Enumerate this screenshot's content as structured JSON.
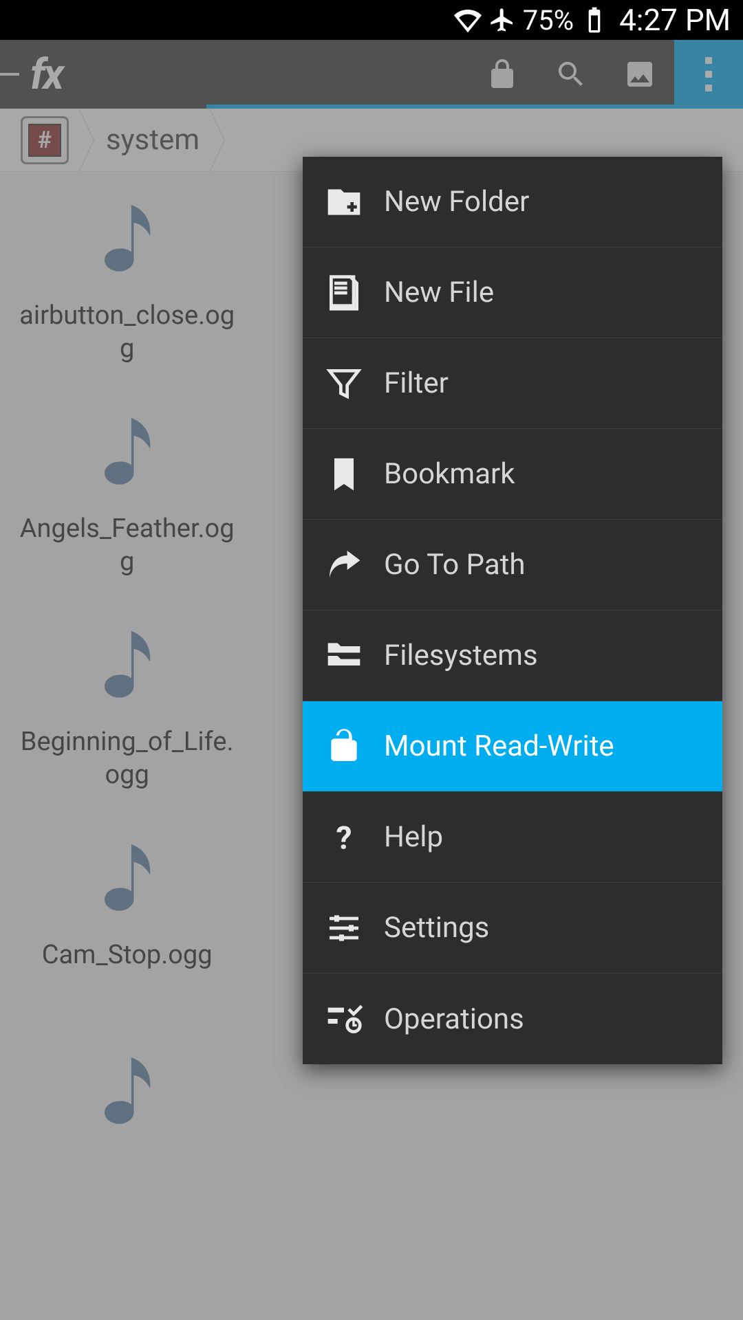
{
  "status": {
    "battery": "75%",
    "time": "4:27 PM"
  },
  "breadcrumb": {
    "root_symbol": "#",
    "segments": [
      "system"
    ]
  },
  "files": [
    {
      "name": "airbutton_close.ogg"
    },
    {
      "name": "Angels_Feather.ogg"
    },
    {
      "name": "Beginning_of_Life.ogg"
    },
    {
      "name": "Cam_Stop.ogg"
    }
  ],
  "menu": {
    "items": [
      {
        "label": "New Folder",
        "highlight": false
      },
      {
        "label": "New File",
        "highlight": false
      },
      {
        "label": "Filter",
        "highlight": false
      },
      {
        "label": "Bookmark",
        "highlight": false
      },
      {
        "label": "Go To Path",
        "highlight": false
      },
      {
        "label": "Filesystems",
        "highlight": false
      },
      {
        "label": "Mount Read-Write",
        "highlight": true
      },
      {
        "label": "Help",
        "highlight": false
      },
      {
        "label": "Settings",
        "highlight": false
      },
      {
        "label": "Operations",
        "highlight": false
      }
    ]
  }
}
